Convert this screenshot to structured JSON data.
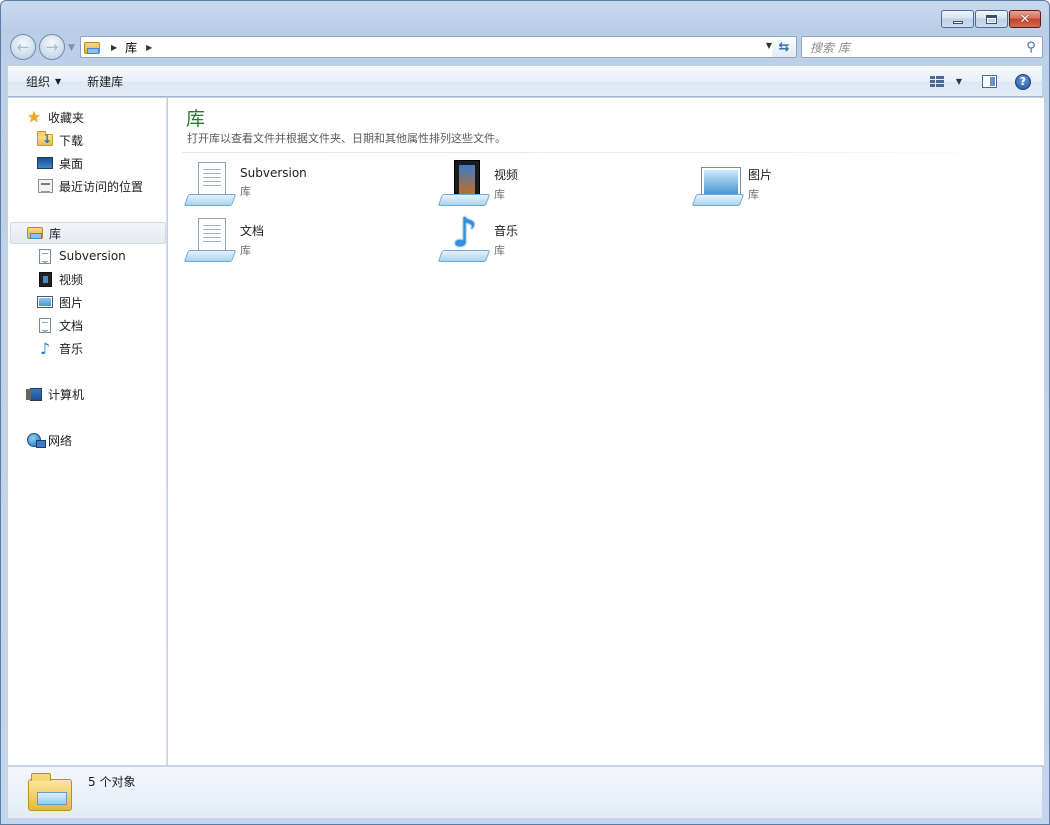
{
  "window": {
    "title": "库"
  },
  "nav": {
    "address_segment": "库",
    "search_placeholder": "搜索 库"
  },
  "toolbar": {
    "organize_label": "组织",
    "new_library_label": "新建库"
  },
  "sidebar": {
    "favorites": {
      "label": "收藏夹",
      "items": [
        {
          "label": "下载",
          "icon": "download-folder-icon"
        },
        {
          "label": "桌面",
          "icon": "desktop-icon"
        },
        {
          "label": "最近访问的位置",
          "icon": "recent-places-icon"
        }
      ]
    },
    "libraries": {
      "label": "库",
      "items": [
        {
          "label": "Subversion",
          "icon": "document-icon"
        },
        {
          "label": "视频",
          "icon": "video-icon"
        },
        {
          "label": "图片",
          "icon": "picture-icon"
        },
        {
          "label": "文档",
          "icon": "document-icon"
        },
        {
          "label": "音乐",
          "icon": "music-icon"
        }
      ]
    },
    "computer": {
      "label": "计算机"
    },
    "network": {
      "label": "网络"
    }
  },
  "content": {
    "title": "库",
    "description": "打开库以查看文件并根据文件夹、日期和其他属性排列这些文件。",
    "tiles": [
      {
        "name": "Subversion",
        "type": "库",
        "icon": "library-document-icon"
      },
      {
        "name": "视频",
        "type": "库",
        "icon": "library-video-icon"
      },
      {
        "name": "图片",
        "type": "库",
        "icon": "library-picture-icon"
      },
      {
        "name": "文档",
        "type": "库",
        "icon": "library-document-icon"
      },
      {
        "name": "音乐",
        "type": "库",
        "icon": "library-music-icon"
      }
    ]
  },
  "status": {
    "count_text": "5 个对象"
  }
}
